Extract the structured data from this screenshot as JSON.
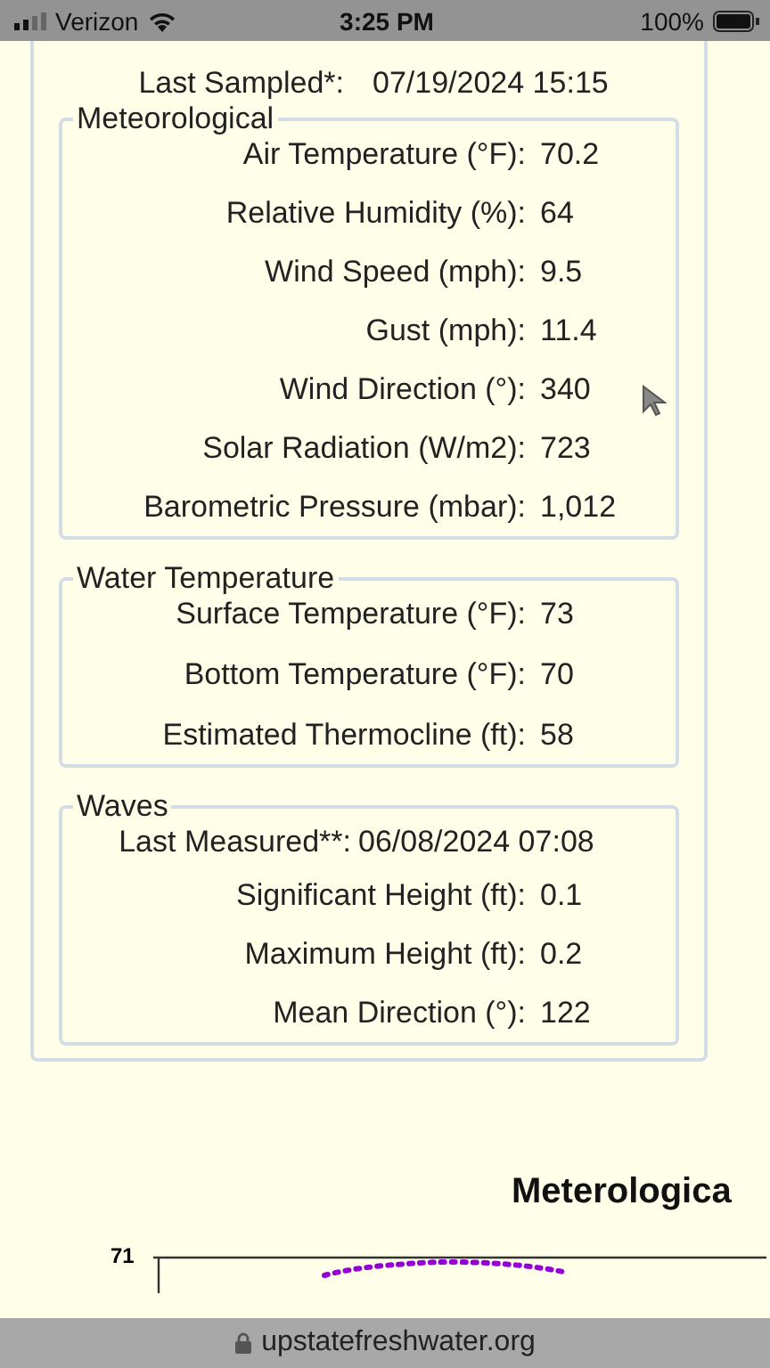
{
  "status_bar": {
    "carrier": "Verizon",
    "time": "3:25 PM",
    "battery": "100%"
  },
  "recent_data": {
    "last_sampled": {
      "label": "Last Sampled*:",
      "value": "07/19/2024 15:15"
    },
    "sections": [
      {
        "legend": "Meteorological",
        "rows": [
          {
            "label": "Air Temperature (°F):",
            "value": "70.2"
          },
          {
            "label": "Relative Humidity (%):",
            "value": "64"
          },
          {
            "label": "Wind Speed (mph):",
            "value": "9.5"
          },
          {
            "label": "Gust (mph):",
            "value": "11.4"
          },
          {
            "label": "Wind Direction (°):",
            "value": "340"
          },
          {
            "label": "Solar Radiation (W/m2):",
            "value": "723"
          },
          {
            "label": "Barometric Pressure (mbar):",
            "value": "1,012"
          }
        ]
      },
      {
        "legend": "Water Temperature",
        "rows": [
          {
            "label": "Surface Temperature (°F):",
            "value": "73"
          },
          {
            "label": "Bottom Temperature (°F):",
            "value": "70"
          },
          {
            "label": "Estimated Thermocline (ft):",
            "value": "58"
          }
        ]
      },
      {
        "legend": "Waves",
        "timestamp": {
          "label": "Last Measured**:",
          "value": "06/08/2024 07:08"
        },
        "rows": [
          {
            "label": "Significant Height (ft):",
            "value": "0.1"
          },
          {
            "label": "Maximum Height (ft):",
            "value": "0.2"
          },
          {
            "label": "Mean Direction (°):",
            "value": "122"
          }
        ]
      }
    ]
  },
  "chart": {
    "title": "Meterologica",
    "y_tick": "71"
  },
  "address_bar": {
    "url": "upstatefreshwater.org"
  }
}
